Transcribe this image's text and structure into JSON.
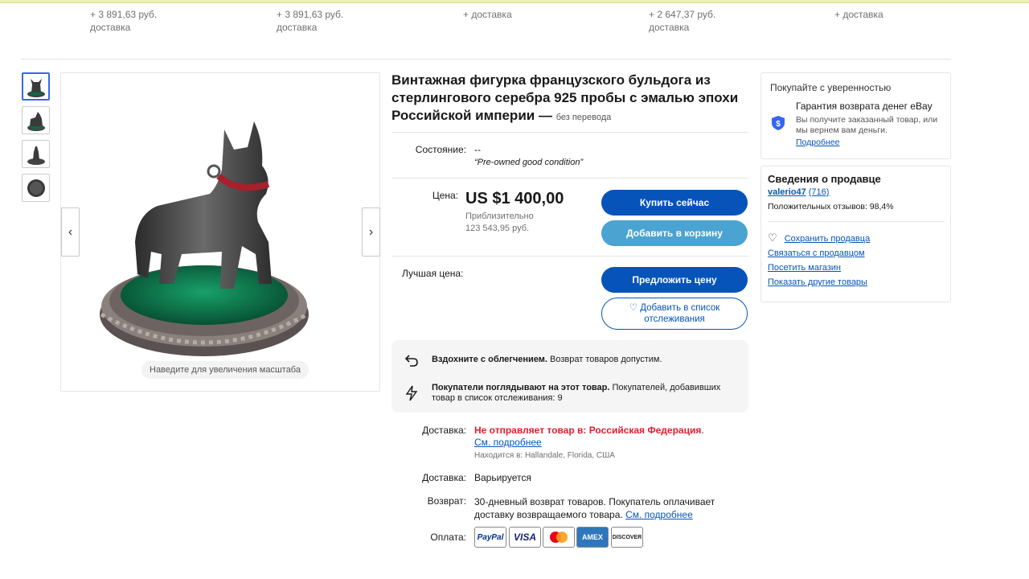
{
  "top_strip": [
    {
      "price": "+ 3 891,63 руб.",
      "shipping": "доставка"
    },
    {
      "price": "+ 3 891,63 руб.",
      "shipping": "доставка"
    },
    {
      "price": "",
      "shipping": "+ доставка"
    },
    {
      "price": "+ 2 647,37 руб.",
      "shipping": "доставка"
    },
    {
      "price": "",
      "shipping": "+ доставка"
    }
  ],
  "gallery": {
    "zoom_hint": "Наведите для увеличения масштаба",
    "prev_icon": "‹",
    "next_icon": "›",
    "thumbnails": [
      "bulldog-front",
      "bulldog-side",
      "bulldog-back",
      "bulldog-bottom"
    ]
  },
  "listing": {
    "title": "Винтажная фигурка французского бульдога из стерлингового серебра 925 пробы с эмалью эпохи Российской империи —",
    "no_translation": "без перевода",
    "condition_label": "Состояние:",
    "condition_value": "--",
    "condition_note": "Pre-owned good condition",
    "price_label": "Цена:",
    "price": "US $1 400,00",
    "approx_label": "Приблизительно",
    "approx_value": "123 543,95 руб.",
    "best_offer_label": "Лучшая цена:",
    "buy_now": "Купить сейчас",
    "add_to_cart": "Добавить в корзину",
    "make_offer": "Предложить цену",
    "watchlist": "Добавить в список отслеживания"
  },
  "highlights": {
    "return_bold": "Вздохните с облегчением.",
    "return_text": "Возврат товаров допустим.",
    "watch_bold": "Покупатели поглядывают на этот товар.",
    "watch_text": "Покупателей, добавивших товар в список отслеживания: 9"
  },
  "shipping": {
    "label": "Доставка:",
    "warning": "Не отправляет товар в: Российская Федерация",
    "more_link": "См. подробнее",
    "located": "Находится в: Hallandale, Florida, США",
    "label2": "Доставка:",
    "varies": "Варьируется",
    "returns_label": "Возврат:",
    "returns_text": "30-дневный возврат товаров. Покупатель оплачивает доставку возвращаемого товара.",
    "returns_link": "См. подробнее",
    "payments_label": "Оплата:",
    "payments": [
      "PayPal",
      "VISA",
      "Mastercard",
      "AMEX",
      "DISCOVER"
    ]
  },
  "confidence": {
    "title": "Покупайте с уверенностью",
    "guarantee_title": "Гарантия возврата денег eBay",
    "guarantee_text": "Вы получите заказанный товар, или мы вернем вам деньги.",
    "more": "Подробнее"
  },
  "seller": {
    "title": "Сведения о продавце",
    "name": "valerio47",
    "score": "(716)",
    "feedback": "Положительных отзывов: 98,4%",
    "save": "Сохранить продавца",
    "contact": "Связаться с продавцом",
    "visit": "Посетить магазин",
    "other": "Показать другие товары"
  },
  "colors": {
    "primary_button": "#0654ba",
    "secondary_button": "#4aa3d0",
    "alert": "#dd1e31",
    "enamel_green": "#0b6b43"
  }
}
